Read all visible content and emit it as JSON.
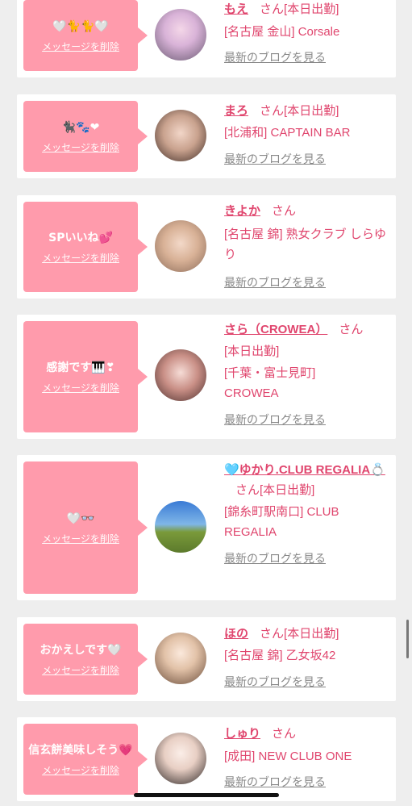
{
  "cards": [
    {
      "message": "🤍🐈🐈🤍",
      "delete_label": "メッセージを削除",
      "name": "もえ",
      "honorific": "さん",
      "status": "[本日出勤]",
      "shop": "[名古屋 金山] Corsale",
      "blog_link": "最新のブログを見る"
    },
    {
      "message": "🐈‍⬛🐾❤",
      "delete_label": "メッセージを削除",
      "name": "まろ",
      "honorific": "さん",
      "status": "[本日出勤]",
      "shop": "[北浦和] CAPTAIN BAR",
      "blog_link": "最新のブログを見る"
    },
    {
      "message": "SPいいね💕",
      "delete_label": "メッセージを削除",
      "name": "きよか",
      "honorific": "さん",
      "status": "",
      "shop": "[名古屋 錦] 熟女クラブ しらゆり",
      "blog_link": "最新のブログを見る"
    },
    {
      "message": "感謝です🎹❣",
      "delete_label": "メッセージを削除",
      "name": "さら（CROWEA）",
      "honorific": "さん",
      "status": "[本日出勤]",
      "shop": "[千葉・富士見町] CROWEA",
      "blog_link": "最新のブログを見る"
    },
    {
      "message": "🤍👓",
      "delete_label": "メッセージを削除",
      "name": "🩵ゆかり.CLUB REGALIA💍",
      "honorific": "さん",
      "status": "[本日出勤]",
      "shop": "[錦糸町駅南口] CLUB REGALIA",
      "blog_link": "最新のブログを見る"
    },
    {
      "message": "おかえしです🤍",
      "delete_label": "メッセージを削除",
      "name": "ほの",
      "honorific": "さん",
      "status": "[本日出勤]",
      "shop": "[名古屋 錦] 乙女坂42",
      "blog_link": "最新のブログを見る"
    },
    {
      "message": "信玄餅美味しそう💗",
      "delete_label": "メッセージを削除",
      "name": "しゅり",
      "honorific": "さん",
      "status": "",
      "shop": "[成田] NEW CLUB ONE",
      "blog_link": "最新のブログを見る"
    }
  ],
  "colors": {
    "bubble": "#ff9bac",
    "accent": "#e0466e",
    "link_gray": "#888888",
    "background": "#eeeeee"
  }
}
